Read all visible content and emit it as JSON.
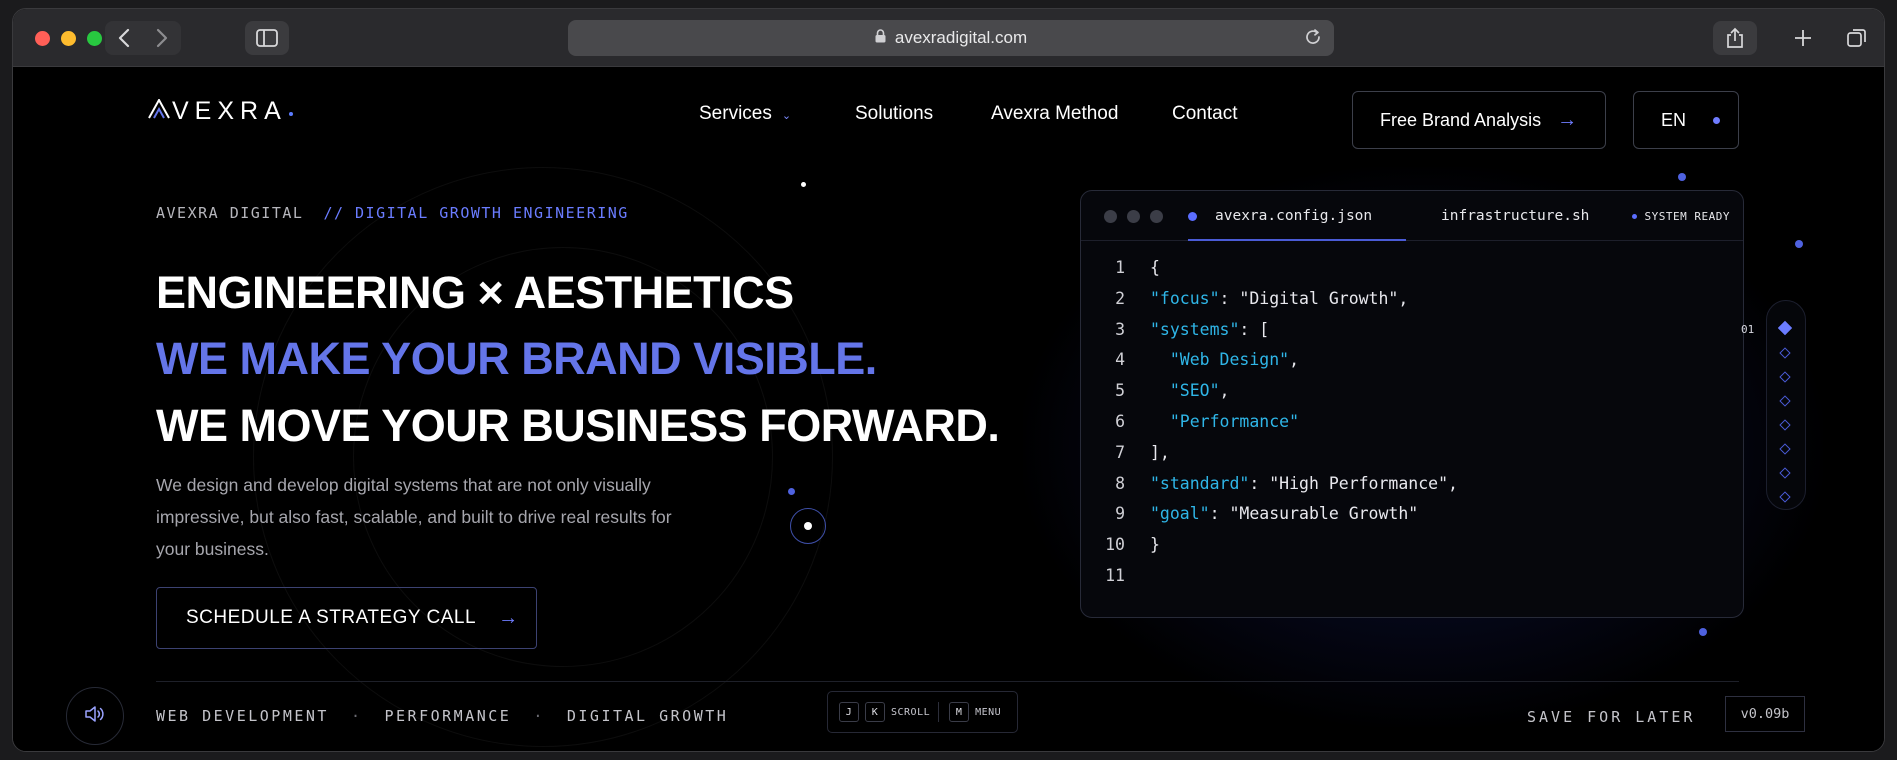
{
  "browser": {
    "url": "avexradigital.com"
  },
  "brand": {
    "logo_text": "VEXRA"
  },
  "nav": {
    "items": [
      {
        "label": "Services"
      },
      {
        "label": "Solutions"
      },
      {
        "label": "Avexra Method"
      },
      {
        "label": "Contact"
      }
    ],
    "cta_label": "Free Brand Analysis",
    "lang_label": "EN"
  },
  "hero": {
    "kicker": "AVEXRA DIGITAL",
    "kicker_accent": "// DIGITAL GROWTH ENGINEERING",
    "line1": "ENGINEERING × AESTHETICS",
    "line2": "WE MAKE YOUR BRAND VISIBLE.",
    "line3": "WE MOVE YOUR BUSINESS FORWARD.",
    "description": "We design and develop digital systems that are not only visually impressive, but also fast, scalable, and built to drive real results for your business.",
    "cta_label": "SCHEDULE A STRATEGY CALL"
  },
  "code_panel": {
    "tab_active": "avexra.config.json",
    "tab_other": "infrastructure.sh",
    "status": "SYSTEM READY",
    "lines": [
      {
        "n": "1"
      },
      {
        "n": "2"
      },
      {
        "n": "3"
      },
      {
        "n": "4"
      },
      {
        "n": "5"
      },
      {
        "n": "6"
      },
      {
        "n": "7"
      },
      {
        "n": "8"
      },
      {
        "n": "9"
      },
      {
        "n": "10"
      },
      {
        "n": "11"
      }
    ],
    "tokens": {
      "open_brace": "{",
      "focus_key": "\"focus\"",
      "focus_val": "\"Digital Growth\"",
      "systems_key": "\"systems\"",
      "item_web": "\"Web Design\"",
      "item_seo": "\"SEO\"",
      "item_perf": "\"Performance\"",
      "standard_key": "\"standard\"",
      "standard_val": "\"High Performance\"",
      "goal_key": "\"goal\"",
      "goal_val": "\"Measurable Growth\"",
      "close_brace": "}"
    }
  },
  "pager": {
    "current": "01"
  },
  "footer": {
    "tags": [
      "WEB DEVELOPMENT",
      "PERFORMANCE",
      "DIGITAL GROWTH"
    ],
    "separator": "·",
    "key_j": "J",
    "key_k": "K",
    "scroll_label": "SCROLL",
    "key_m": "M",
    "menu_label": "MENU",
    "save_label": "SAVE FOR LATER",
    "version": "v0.09b"
  },
  "colors": {
    "accent": "#6475e9",
    "code_key": "#2fb6e8"
  },
  "icons": [
    "back-icon",
    "forward-icon",
    "sidebar-icon",
    "lock-icon",
    "reload-icon",
    "share-icon",
    "plus-icon",
    "tabs-icon",
    "arrow-right-icon",
    "chevron-down-icon",
    "speaker-icon"
  ]
}
